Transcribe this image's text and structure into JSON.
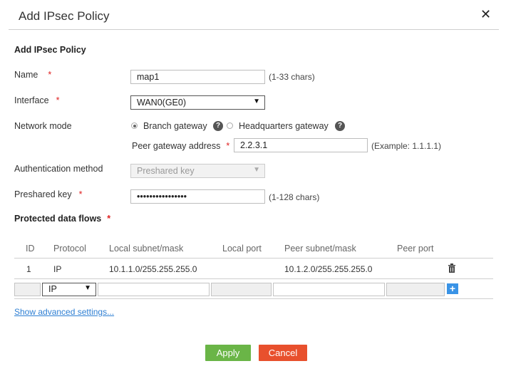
{
  "dialog": {
    "title": "Add IPsec Policy"
  },
  "section": {
    "title": "Add IPsec Policy"
  },
  "form": {
    "name": {
      "label": "Name",
      "required": "*",
      "value": "map1",
      "hint": "(1-33 chars)"
    },
    "interface": {
      "label": "Interface",
      "required": "*",
      "selected": "WAN0(GE0)"
    },
    "network_mode": {
      "label": "Network mode",
      "options": [
        {
          "label": "Branch gateway",
          "checked": true
        },
        {
          "label": "Headquarters gateway",
          "checked": false
        }
      ],
      "help": "?"
    },
    "peer_gateway": {
      "label": "Peer gateway address",
      "required": "*",
      "value": "2.2.3.1",
      "hint": "(Example: 1.1.1.1)"
    },
    "auth_method": {
      "label": "Authentication method",
      "selected": "Preshared key"
    },
    "preshared_key": {
      "label": "Preshared key",
      "required": "*",
      "value": "••••••••••••••••",
      "hint": "(1-128 chars)"
    }
  },
  "flows": {
    "title": "Protected data flows",
    "required": "*",
    "headers": [
      "ID",
      "Protocol",
      "Local subnet/mask",
      "Local port",
      "Peer subnet/mask",
      "Peer port"
    ],
    "rows": [
      {
        "id": "1",
        "protocol": "IP",
        "local_subnet": "10.1.1.0/255.255.255.0",
        "local_port": "",
        "peer_subnet": "10.1.2.0/255.255.255.0",
        "peer_port": ""
      }
    ],
    "new_row": {
      "protocol": "IP"
    }
  },
  "advanced_link": "Show advanced settings...",
  "buttons": {
    "apply": "Apply",
    "cancel": "Cancel"
  },
  "colors": {
    "apply": "#6ab547",
    "cancel": "#e8502d",
    "link": "#2e7fd3",
    "required": "#e02020"
  },
  "icons": {
    "close": "close-icon",
    "delete": "trash-icon",
    "add": "plus-icon",
    "help": "help-icon"
  }
}
